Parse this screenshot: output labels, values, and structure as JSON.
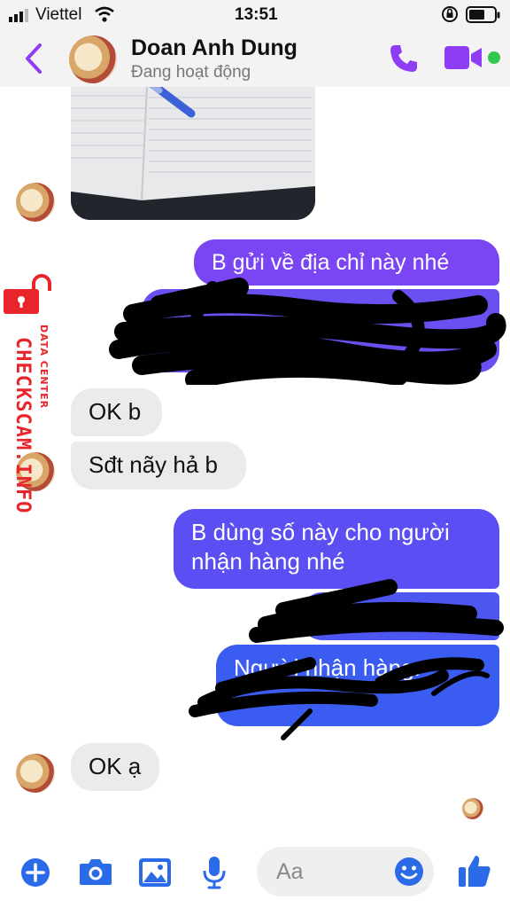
{
  "status_bar": {
    "carrier": "Viettel",
    "time": "13:51"
  },
  "header": {
    "contact_name": "Doan Anh Dung",
    "status": "Đang hoạt động"
  },
  "watermark": {
    "label": "DATA CENTER",
    "site": "CHECKSCAM.INFO"
  },
  "messages": [
    {
      "from": "me",
      "text": "B gửi về địa chỉ này nhé"
    },
    {
      "from": "contact",
      "text": "OK b"
    },
    {
      "from": "contact",
      "text": "Sđt nãy hả b"
    },
    {
      "from": "me",
      "text": "B dùng số này cho người nhận hàng nhé"
    },
    {
      "from": "me",
      "text": "Người nhận hàng:"
    },
    {
      "from": "contact",
      "text": "OK ạ"
    }
  ],
  "composer": {
    "placeholder": "Aa"
  },
  "colors": {
    "accent": "#8f3cf5",
    "sent_top": "#7a45f2",
    "sent_bottom": "#3b5cf0",
    "watermark": "#e8252a"
  }
}
